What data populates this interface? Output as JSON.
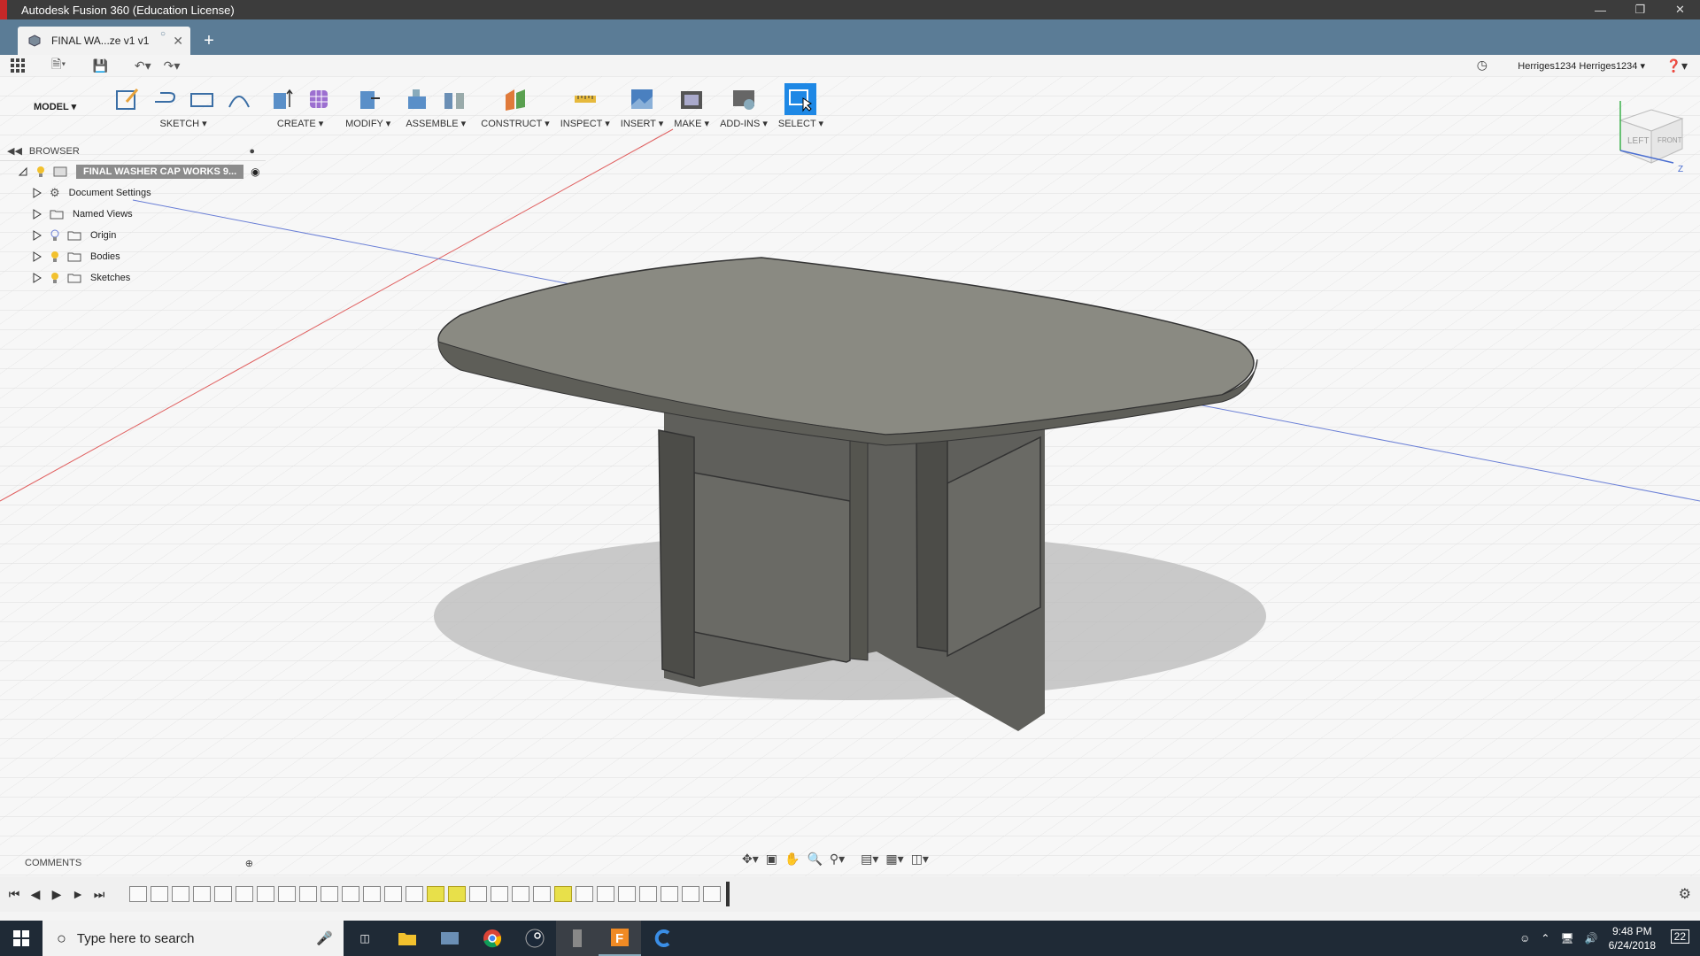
{
  "window": {
    "title": "Autodesk Fusion 360 (Education License)"
  },
  "tab": {
    "label": "FINAL WA...ze v1 v1"
  },
  "user": {
    "name": "Herriges1234 Herriges1234"
  },
  "toolbar": {
    "workspace": "MODEL",
    "groups": [
      {
        "label": "SKETCH"
      },
      {
        "label": "CREATE"
      },
      {
        "label": "MODIFY"
      },
      {
        "label": "ASSEMBLE"
      },
      {
        "label": "CONSTRUCT"
      },
      {
        "label": "INSPECT"
      },
      {
        "label": "INSERT"
      },
      {
        "label": "MAKE"
      },
      {
        "label": "ADD-INS"
      },
      {
        "label": "SELECT"
      }
    ]
  },
  "browser": {
    "title": "BROWSER",
    "root": "FINAL WASHER CAP WORKS 9...",
    "items": [
      {
        "label": "Document Settings",
        "icon": "gear-icon"
      },
      {
        "label": "Named Views",
        "icon": "folder-icon"
      },
      {
        "label": "Origin",
        "icon": "folder-icon"
      },
      {
        "label": "Bodies",
        "icon": "folder-icon"
      },
      {
        "label": "Sketches",
        "icon": "folder-icon"
      }
    ]
  },
  "comments": {
    "label": "COMMENTS"
  },
  "viewcube": {
    "left": "LEFT",
    "front": "FRONT",
    "axis": "Z"
  },
  "taskbar": {
    "search_placeholder": "Type here to search",
    "time": "9:48 PM",
    "date": "6/24/2018",
    "notifications": "22"
  },
  "colors": {
    "titlebar": "#3c3c3c",
    "tabbar": "#5b7c96",
    "select_accent": "#1e88e5",
    "taskbar": "#1f2a36",
    "timeline_highlight": "#e8e04a"
  },
  "timeline": {
    "highlighted": [
      14,
      15,
      20
    ]
  }
}
